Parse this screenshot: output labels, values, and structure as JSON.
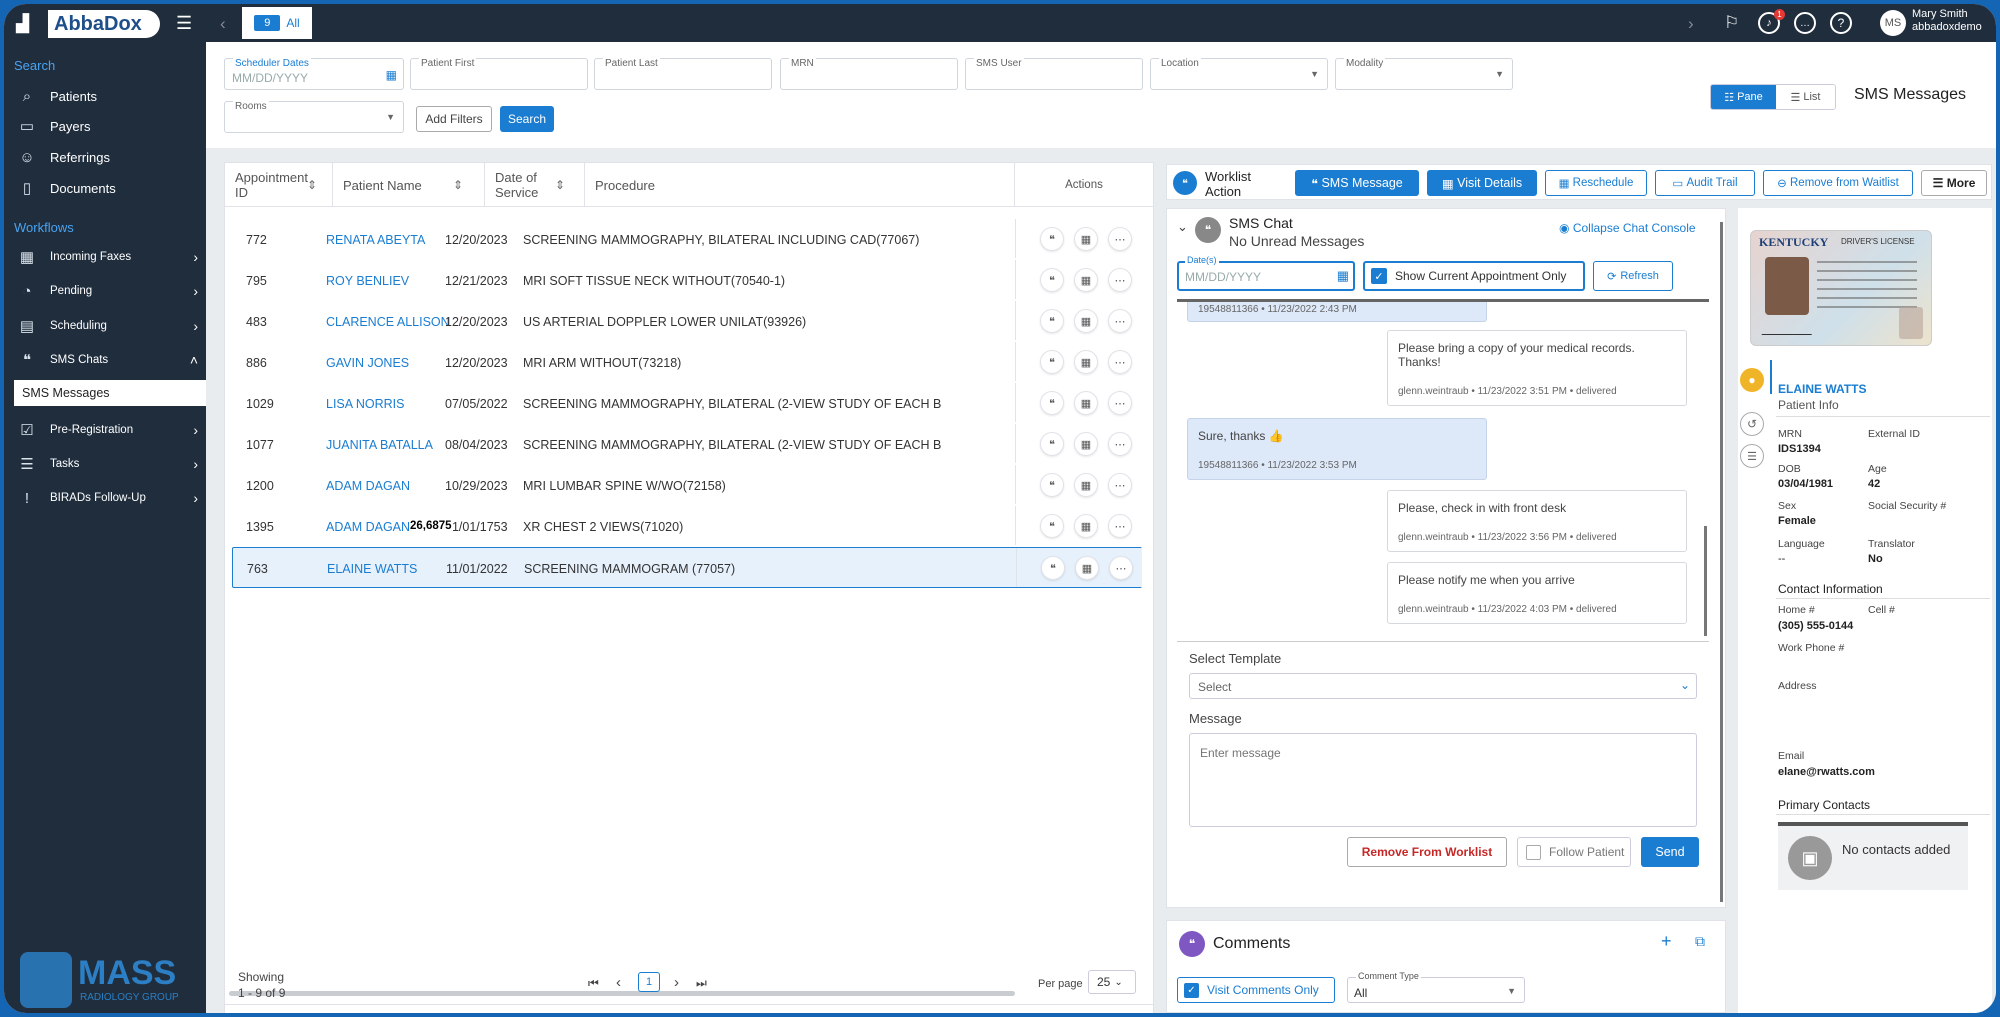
{
  "topbar": {
    "tab_count": "9",
    "tab_label": "All",
    "user_name": "Mary Smith",
    "user_sub": "abbadoxdemo",
    "avatar_initials": "MS",
    "notif_count": "1"
  },
  "brand": {
    "logo_text": "AbbaDox",
    "footer_main": "MASS",
    "footer_sub": "RADIOLOGY GROUP"
  },
  "sidebar": {
    "search_heading": "Search",
    "search_items": [
      "Patients",
      "Payers",
      "Referrings",
      "Documents"
    ],
    "workflows_heading": "Workflows",
    "workflow_items": [
      "Incoming Faxes",
      "Pending",
      "Scheduling",
      "SMS Chats"
    ],
    "active_sub": "SMS Messages",
    "more_items": [
      "Pre-Registration",
      "Tasks",
      "BIRADs Follow-Up"
    ]
  },
  "filters": {
    "scheduler_dates_label": "Scheduler Dates",
    "scheduler_dates_ph": "MM/DD/YYYY",
    "patient_first": "Patient First",
    "patient_last": "Patient Last",
    "mrn": "MRN",
    "sms_user": "SMS User",
    "location": "Location",
    "modality": "Modality",
    "rooms": "Rooms",
    "add_filters": "Add Filters",
    "search": "Search"
  },
  "view": {
    "pane": "Pane",
    "list": "List",
    "page_title": "SMS Messages"
  },
  "table": {
    "headers": [
      "Appointment ID",
      "Patient Name",
      "Date of Service",
      "Procedure",
      "Actions"
    ],
    "rows": [
      {
        "id": "772",
        "name": "RENATA ABEYTA",
        "date": "12/20/2023",
        "proc": "SCREENING MAMMOGRAPHY, BILATERAL INCLUDING CAD(77067)"
      },
      {
        "id": "795",
        "name": "ROY BENLIEV",
        "date": "12/21/2023",
        "proc": "MRI SOFT TISSUE NECK WITHOUT(70540-1)"
      },
      {
        "id": "483",
        "name": "CLARENCE ALLISON",
        "date": "12/20/2023",
        "proc": "US ARTERIAL DOPPLER LOWER UNILAT(93926)"
      },
      {
        "id": "886",
        "name": "GAVIN JONES",
        "date": "12/20/2023",
        "proc": "MRI ARM WITHOUT(73218)"
      },
      {
        "id": "1029",
        "name": "LISA NORRIS",
        "date": "07/05/2022",
        "proc": "SCREENING MAMMOGRAPHY, BILATERAL (2-VIEW STUDY OF EACH B"
      },
      {
        "id": "1077",
        "name": "JUANITA BATALLA",
        "date": "08/04/2023",
        "proc": "SCREENING MAMMOGRAPHY, BILATERAL (2-VIEW STUDY OF EACH B"
      },
      {
        "id": "1200",
        "name": "ADAM DAGAN",
        "date": "10/29/2023",
        "proc": "MRI LUMBAR SPINE W/WO(72158)"
      },
      {
        "id": "1395",
        "name": "ADAM DAGAN",
        "date": "01/01/1753",
        "proc": "XR CHEST 2 VIEWS(71020)",
        "overlay": "26,6875"
      },
      {
        "id": "763",
        "name": "ELAINE WATTS",
        "date": "11/01/2022",
        "proc": "SCREENING MAMMOGRAM (77057)"
      }
    ],
    "showing_label": "Showing",
    "showing_range": "1 - 9 of 9",
    "current_page": "1",
    "per_page_label": "Per page",
    "per_page": "25"
  },
  "worklist": {
    "title_1": "Worklist",
    "title_2": "Action",
    "sms_message": "SMS Message",
    "visit_details": "Visit Details",
    "reschedule": "Reschedule",
    "audit_trail": "Audit Trail",
    "remove_waitlist": "Remove from Waitlist",
    "more": "More"
  },
  "chat": {
    "title": "SMS Chat",
    "subtitle": "No Unread Messages",
    "collapse": "Collapse Chat Console",
    "dates_label": "Date(s)",
    "dates_ph": "MM/DD/YYYY",
    "show_current": "Show Current Appointment Only",
    "refresh": "Refresh",
    "truncated_meta": "19548811366  •  11/23/2022 2:43 PM",
    "messages": [
      {
        "text": "Please bring a copy of your medical records. Thanks!",
        "meta": "glenn.weintraub  •  11/23/2022 3:51 PM  •  delivered"
      },
      {
        "text": "Sure, thanks 👍",
        "meta": "19548811366  •  11/23/2022 3:53 PM"
      },
      {
        "text": "Please, check in with front desk",
        "meta": "glenn.weintraub  •  11/23/2022 3:56 PM  •  delivered"
      },
      {
        "text": "Please notify me when you arrive",
        "meta": "glenn.weintraub  •  11/23/2022 4:03 PM  •  delivered"
      }
    ],
    "select_template": "Select Template",
    "select_ph": "Select",
    "message_label": "Message",
    "message_ph": "Enter message",
    "remove_worklist": "Remove From Worklist",
    "follow_patient": "Follow Patient",
    "send": "Send"
  },
  "comments": {
    "title": "Comments",
    "visit_only": "Visit Comments Only",
    "type_label": "Comment Type",
    "type_value": "All"
  },
  "patient": {
    "license_state": "KENTUCKY",
    "license_type": "DRIVER'S LICENSE",
    "name": "ELAINE WATTS",
    "sub": "Patient Info",
    "mrn_l": "MRN",
    "mrn": "IDS1394",
    "ext_l": "External ID",
    "dob_l": "DOB",
    "dob": "03/04/1981",
    "age_l": "Age",
    "age": "42",
    "sex_l": "Sex",
    "sex": "Female",
    "ssn_l": "Social Security #",
    "lang_l": "Language",
    "lang": "--",
    "trans_l": "Translator",
    "trans": "No",
    "contact_heading": "Contact Information",
    "home_l": "Home #",
    "home": "(305) 555-0144",
    "cell_l": "Cell #",
    "work_l": "Work Phone #",
    "address_l": "Address",
    "email_l": "Email",
    "email": "elane@rwatts.com",
    "primary_heading": "Primary Contacts",
    "no_contacts": "No contacts added"
  }
}
